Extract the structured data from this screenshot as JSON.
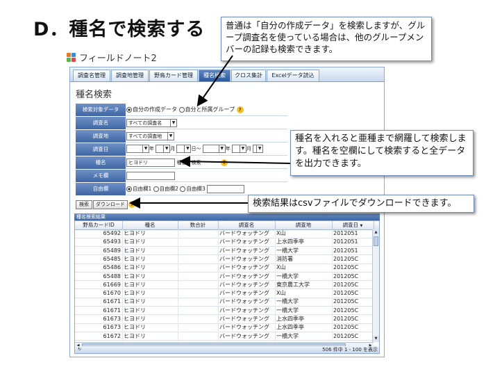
{
  "slide": {
    "title": "D．種名で検索する",
    "callout_top": "普通は「自分の作成データ」を検索しますが、グループ調査名を使っている場合は、他のグループメンバーの記録も検索できます。",
    "callout_mid": "種名を入れると亜種まで網羅して検索します。種名を空欄にして検索すると全データを出力できます。",
    "callout_bottom": "検索結果はcsvファイルでダウンロードできます。"
  },
  "app": {
    "title": "フィールドノート2",
    "tabs": [
      "調査名管理",
      "調査地管理",
      "野鳥カード管理",
      "種名検索",
      "クロス集計",
      "Excelデータ読込"
    ],
    "active_tab": "種名検索",
    "panel_title": "種名検索"
  },
  "form": {
    "target_label": "検索対象データ",
    "target_opt1": "自分の作成データ",
    "target_opt2": "自分と所属グループ",
    "survey_label": "調査名",
    "survey_value": "すべての調査名",
    "site_label": "調査地",
    "site_value": "すべての調査地",
    "date_label": "調査日",
    "date_year": "年",
    "date_month": "月",
    "date_day_from": "日〜",
    "species_label": "種名",
    "species_value": "ヒヨドリ",
    "species_hint": "種名で検索",
    "memo_label": "メモ欄",
    "free_label": "自由欄",
    "free_opt1": "自由欄1",
    "free_opt2": "自由欄2",
    "free_opt3": "自由欄3",
    "help_glyph": "?"
  },
  "buttons": {
    "search": "検索",
    "download": "ダウンロード"
  },
  "results": {
    "title": "種名検索結果",
    "columns": [
      "野鳥カードID",
      "種名",
      "数合計",
      "調査名",
      "調査地",
      "調査日"
    ],
    "rows": [
      [
        "65492",
        "ヒヨドリ",
        "",
        "バードウォッチング",
        "X山",
        "2012051"
      ],
      [
        "65493",
        "ヒヨドリ",
        "",
        "バードウォッチング",
        "上水四季亭",
        "2012051"
      ],
      [
        "65489",
        "ヒヨドリ",
        "",
        "バードウォッチング",
        "一橋大学",
        "2012051"
      ],
      [
        "65485",
        "ヒヨドリ",
        "",
        "バードウォッチング",
        "消防署",
        "201205C"
      ],
      [
        "65486",
        "ヒヨドリ",
        "",
        "バードウォッチング",
        "X山",
        "201205C"
      ],
      [
        "65488",
        "ヒヨドリ",
        "",
        "バードウォッチング",
        "一橋大学",
        "201205C"
      ],
      [
        "61669",
        "ヒヨドリ",
        "",
        "バードウォッチング",
        "東京農工大学",
        "201205C"
      ],
      [
        "61670",
        "ヒヨドリ",
        "",
        "バードウォッチング",
        "X山",
        "201205C"
      ],
      [
        "61671",
        "ヒヨドリ",
        "",
        "バードウォッチング",
        "一橋大学",
        "201205C"
      ],
      [
        "61671",
        "ヒヨドリ",
        "",
        "バードウォッチング",
        "一橋大学",
        "201205C"
      ],
      [
        "61673",
        "ヒヨドリ",
        "",
        "バードウォッチング",
        "上水四季亭",
        "201205C"
      ],
      [
        "61673",
        "ヒヨドリ",
        "",
        "バードウォッチング",
        "上水四季亭",
        "201205C"
      ],
      [
        "61672",
        "ヒヨドリ",
        "",
        "バードウォッチング",
        "一橋大学",
        "201205C"
      ]
    ],
    "status": "506 件中 1 - 100 を表示"
  },
  "colors": {
    "accent": "#3e66a5",
    "callout_border": "#6f8fc0"
  }
}
